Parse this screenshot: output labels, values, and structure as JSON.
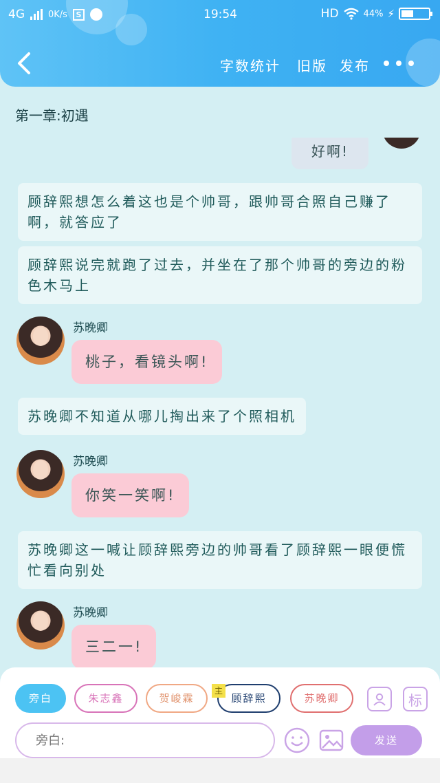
{
  "status_bar": {
    "network": "4G",
    "speed": "0K/s",
    "s_badge": "S",
    "time": "19:54",
    "hd": "HD",
    "battery_percent": "44%",
    "battery_level": 0.44
  },
  "nav": {
    "word_count": "字数统计",
    "old_version": "旧版",
    "publish": "发布"
  },
  "chapter_title": "第一章:初遇",
  "messages": [
    {
      "type": "self",
      "text": "好啊!"
    },
    {
      "type": "narration",
      "text": "顾辞熙想怎么着这也是个帅哥，跟帅哥合照自己赚了啊，就答应了"
    },
    {
      "type": "narration",
      "text": "顾辞熙说完就跑了过去，并坐在了那个帅哥的旁边的粉色木马上"
    },
    {
      "type": "character",
      "speaker": "苏晚卿",
      "text": "桃子，看镜头啊!"
    },
    {
      "type": "narration",
      "text": "苏晚卿不知道从哪儿掏出来了个照相机"
    },
    {
      "type": "character",
      "speaker": "苏晚卿",
      "text": "你笑一笑啊!"
    },
    {
      "type": "narration",
      "text": "苏晚卿这一喊让顾辞熙旁边的帅哥看了顾辞熙一眼便慌忙看向别处"
    },
    {
      "type": "character",
      "speaker": "苏晚卿",
      "text": "三二一!"
    }
  ],
  "bottom": {
    "characters": [
      "旁白",
      "朱志鑫",
      "贺峻霖",
      "顾辞熙",
      "苏晚卿"
    ],
    "new_tag": "主",
    "tag_button": "标",
    "input_placeholder": "旁白:",
    "send": "发送"
  },
  "colors": {
    "header": "#3fb2f3",
    "background": "#d4eff3",
    "pink_bubble": "#fbcbd6",
    "send_button": "#c39ee9",
    "narrator_active": "#4cc3f3"
  }
}
